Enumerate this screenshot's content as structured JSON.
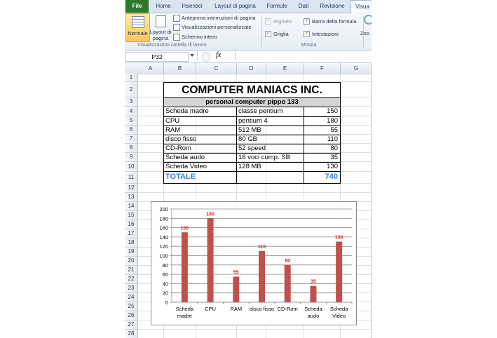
{
  "ribbon": {
    "tabs": [
      "File",
      "Home",
      "Inserisci",
      "Layout di pagina",
      "Formule",
      "Dati",
      "Revisione",
      "Visua"
    ],
    "normale_label": "Normale",
    "layout_label_1": "Layout di",
    "layout_label_2": "pagina",
    "anteprima_label": "Anteprima interruzioni di pagina",
    "personalizzate_label": "Visualizzazioni personalizzate",
    "schermo_label": "Schermo intero",
    "group_views_label": "Visualizzazioni cartella di lavoro",
    "righello_label": "Righello",
    "barra_label": "Barra della formula",
    "griglia_label": "Griglia",
    "intestazioni_label": "Intestazioni",
    "group_mostra_label": "Mostra",
    "zoom_label": "Zoo"
  },
  "formula_bar": {
    "name_box": "P32",
    "fx_label": "fx",
    "formula": ""
  },
  "columns": [
    "A",
    "B",
    "C",
    "D",
    "E",
    "F",
    "G"
  ],
  "rows": [
    "1",
    "2",
    "3",
    "4",
    "5",
    "6",
    "7",
    "8",
    "9",
    "10",
    "11",
    "12",
    "13",
    "14",
    "15",
    "16",
    "17",
    "18",
    "19",
    "20",
    "21",
    "22",
    "23",
    "24",
    "25",
    "26",
    "27",
    "28"
  ],
  "table": {
    "title": "COMPUTER MANIACS INC.",
    "subtitle": "personal computer pippo 133",
    "items": [
      {
        "name": "Scheda madre",
        "desc": "classe pentium",
        "price": "150"
      },
      {
        "name": "CPU",
        "desc": "pentium 4",
        "price": "180"
      },
      {
        "name": "RAM",
        "desc": "512 MB",
        "price": "55"
      },
      {
        "name": "disco fisso",
        "desc": "80 GB",
        "price": "110"
      },
      {
        "name": "CD-Rom",
        "desc": "52 speed",
        "price": "80"
      },
      {
        "name": "Scheda audo",
        "desc": "16 voci comp. SB",
        "price": "35"
      },
      {
        "name": "Scheda Video",
        "desc": "128 MB",
        "price": "130"
      }
    ],
    "total_label": "TOTALE",
    "total_value": "740"
  },
  "chart_data": {
    "type": "bar",
    "categories": [
      "Scheda madre",
      "CPU",
      "RAM",
      "disco fisso",
      "CD-Rom",
      "Scheda audo",
      "Scheda Video"
    ],
    "category_lines": [
      [
        "Scheda",
        "madre"
      ],
      [
        "CPU"
      ],
      [
        "RAM"
      ],
      [
        "disco fisso"
      ],
      [
        "CD-Rom"
      ],
      [
        "Scheda",
        "audo"
      ],
      [
        "Scheda",
        "Video"
      ]
    ],
    "values": [
      150,
      180,
      55,
      110,
      80,
      35,
      130
    ],
    "ylim": [
      0,
      200
    ],
    "yticks": [
      "0",
      "20",
      "40",
      "60",
      "80",
      "100",
      "120",
      "140",
      "160",
      "180",
      "200"
    ],
    "grid": true,
    "bar_color": "#c0504d",
    "label_color": "#e0202a"
  },
  "colors": {
    "accent_blue": "#3b7dd8",
    "header_gray": "#d4d4d4",
    "file_tab": "#2a7a2a"
  }
}
